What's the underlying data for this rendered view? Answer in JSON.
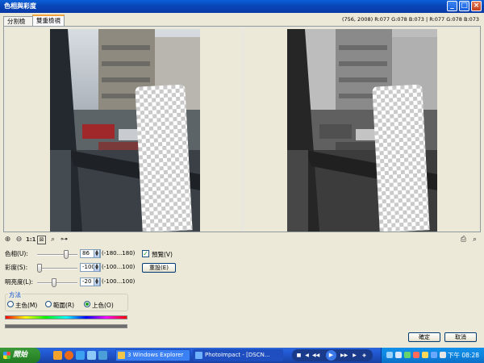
{
  "window": {
    "title": "色相與彩度",
    "buttons": {
      "minimize": "_",
      "maximize": "□",
      "close": "×"
    }
  },
  "tabs": [
    {
      "label": "分割檢視",
      "active": false
    },
    {
      "label": "雙重檢視",
      "active": true
    }
  ],
  "info_readout": "(756, 2008) R:077 G:078 B:073 | R:077 G:078 B:073",
  "zoom_toolbar": {
    "actual_size_label": "1:1"
  },
  "adjustments": [
    {
      "label": "色相(U):",
      "value": "86",
      "range": "(-180...180)",
      "slider_fraction": 0.74
    },
    {
      "label": "彩度(S):",
      "value": "-100",
      "range": "(-100...100)",
      "slider_fraction": 0.0
    },
    {
      "label": "明亮度(L):",
      "value": "-20",
      "range": "(-100...100)",
      "slider_fraction": 0.4
    }
  ],
  "preview_checkbox": {
    "label": "預覽(V)",
    "checked": true
  },
  "reset_button": "重設(E)",
  "method": {
    "title": "方法",
    "options": [
      {
        "label": "主色(M)",
        "selected": false
      },
      {
        "label": "範圍(R)",
        "selected": false
      },
      {
        "label": "上色(O)",
        "selected": true
      }
    ]
  },
  "dialog_buttons": {
    "ok": "確定",
    "cancel": "取消"
  },
  "taskbar": {
    "start_label": "開始",
    "tasks": [
      {
        "label": "3 Windows Explorer",
        "active": false
      },
      {
        "label": "PhotoImpact - [DSCN...",
        "active": true
      }
    ],
    "clock": "下午 08:28"
  },
  "colors": {
    "title_bar": "#0a4fd0",
    "dialog_bg": "#ece9d8",
    "taskbar": "#245edb",
    "start_button": "#2e8c2c"
  }
}
